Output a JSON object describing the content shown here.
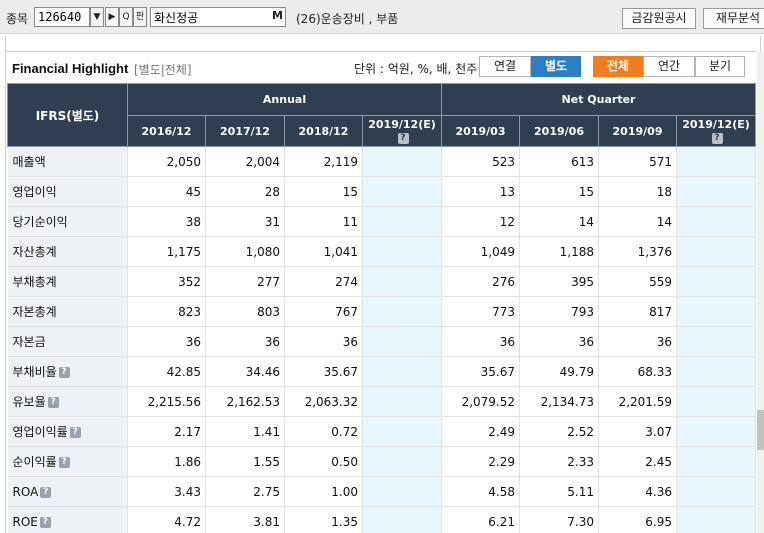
{
  "search": {
    "label": "종목",
    "code": "126640",
    "name": "화신정공",
    "m_label": "M",
    "industry": "(26)운송장비 , 부품",
    "btn_dropdown": "▼",
    "btn_next": "▶",
    "btn_search": "Q",
    "btn_pan": "판",
    "btn_disclosure": "금감원공시",
    "btn_finance": "재무분석"
  },
  "section": {
    "title": "Financial Highlight",
    "sub": "[별도|전체]",
    "unit": "단위 : 억원, %, 배, 천주",
    "toggles1": [
      "연결",
      "별도"
    ],
    "toggles2": [
      "전체",
      "연간",
      "분기"
    ]
  },
  "table": {
    "corner": "IFRS(별도)",
    "groups": [
      "Annual",
      "Net Quarter"
    ],
    "periods": [
      "2016/12",
      "2017/12",
      "2018/12",
      "2019/12(E)",
      "2019/03",
      "2019/06",
      "2019/09",
      "2019/12(E)"
    ],
    "rows": [
      {
        "label": "매출액",
        "icon": false,
        "values": [
          "2,050",
          "2,004",
          "2,119",
          "",
          "523",
          "613",
          "571",
          ""
        ]
      },
      {
        "label": "영업이익",
        "icon": false,
        "values": [
          "45",
          "28",
          "15",
          "",
          "13",
          "15",
          "18",
          ""
        ]
      },
      {
        "label": "당기순이익",
        "icon": false,
        "values": [
          "38",
          "31",
          "11",
          "",
          "12",
          "14",
          "14",
          ""
        ]
      },
      {
        "label": "자산총계",
        "icon": false,
        "values": [
          "1,175",
          "1,080",
          "1,041",
          "",
          "1,049",
          "1,188",
          "1,376",
          ""
        ]
      },
      {
        "label": "부채총계",
        "icon": false,
        "values": [
          "352",
          "277",
          "274",
          "",
          "276",
          "395",
          "559",
          ""
        ]
      },
      {
        "label": "자본총계",
        "icon": false,
        "values": [
          "823",
          "803",
          "767",
          "",
          "773",
          "793",
          "817",
          ""
        ]
      },
      {
        "label": "자본금",
        "icon": false,
        "values": [
          "36",
          "36",
          "36",
          "",
          "36",
          "36",
          "36",
          ""
        ]
      },
      {
        "label": "부채비율",
        "icon": true,
        "values": [
          "42.85",
          "34.46",
          "35.67",
          "",
          "35.67",
          "49.79",
          "68.33",
          ""
        ]
      },
      {
        "label": "유보율",
        "icon": true,
        "values": [
          "2,215.56",
          "2,162.53",
          "2,063.32",
          "",
          "2,079.52",
          "2,134.73",
          "2,201.59",
          ""
        ]
      },
      {
        "label": "영업이익률",
        "icon": true,
        "values": [
          "2.17",
          "1.41",
          "0.72",
          "",
          "2.49",
          "2.52",
          "3.07",
          ""
        ]
      },
      {
        "label": "순이익률",
        "icon": true,
        "values": [
          "1.86",
          "1.55",
          "0.50",
          "",
          "2.29",
          "2.33",
          "2.45",
          ""
        ]
      },
      {
        "label": "ROA",
        "icon": true,
        "values": [
          "3.43",
          "2.75",
          "1.00",
          "",
          "4.58",
          "5.11",
          "4.36",
          ""
        ]
      },
      {
        "label": "ROE",
        "icon": true,
        "values": [
          "4.72",
          "3.81",
          "1.35",
          "",
          "6.21",
          "7.30",
          "6.95",
          ""
        ]
      }
    ]
  },
  "colors": {
    "header_bg": "#2f3f51",
    "toggle_blue": "#2d7fc3",
    "toggle_orange": "#f07e1e",
    "estimate_bg": "#e8f6fd"
  }
}
